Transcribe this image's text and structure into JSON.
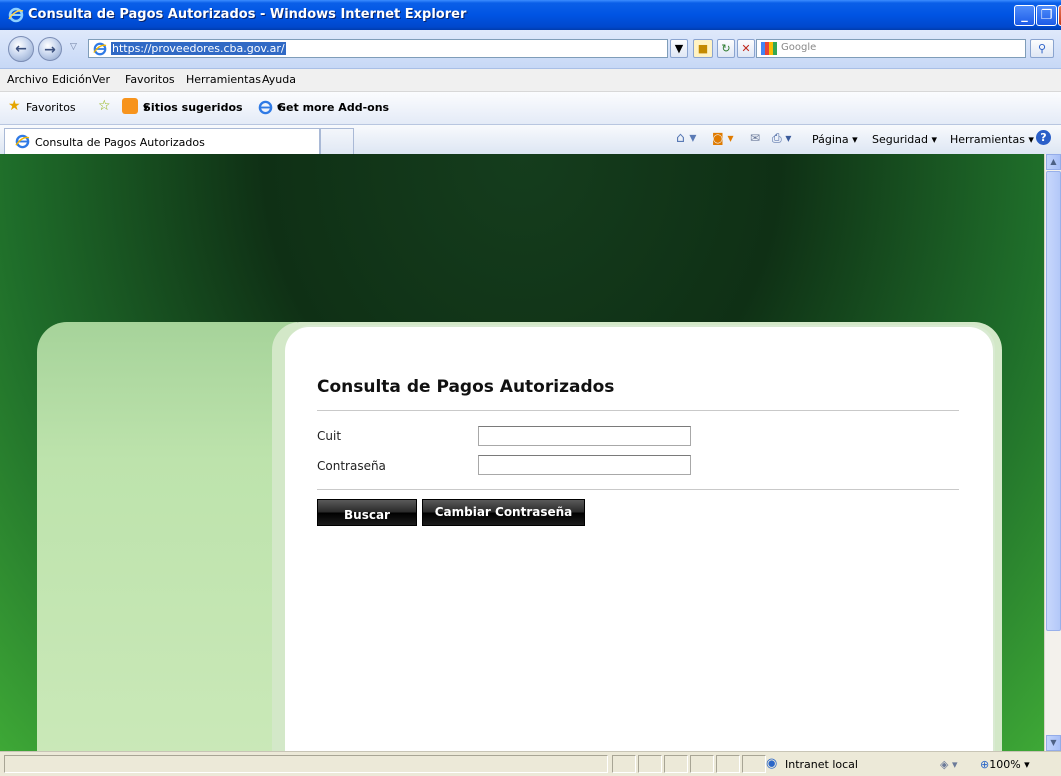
{
  "window": {
    "title": "Consulta de Pagos Autorizados - Windows Internet Explorer",
    "minimize": "_",
    "maximize": "❐",
    "close": "x"
  },
  "address": {
    "url": "https://proveedores.cba.gov.ar/",
    "search_placeholder": "Google"
  },
  "menu": [
    "Archivo",
    "Edición",
    "Ver",
    "Favoritos",
    "Herramientas",
    "Ayuda"
  ],
  "favorites": {
    "label": "Favoritos",
    "suggested": "Sitios sugeridos",
    "addons": "Get more Add-ons"
  },
  "tab": {
    "title": "Consulta de Pagos Autorizados"
  },
  "commands": {
    "page": "Página",
    "security": "Seguridad",
    "tools": "Herramientas"
  },
  "form": {
    "title": "Consulta de Pagos Autorizados",
    "cuit_label": "Cuit",
    "cuit_value": "",
    "password_label": "Contraseña",
    "password_value": "",
    "search_button": "Buscar",
    "change_password_button": "Cambiar Contraseña"
  },
  "status": {
    "zone": "Intranet local",
    "zoom": "100%"
  },
  "colors": {
    "title_bar": "#0054e3",
    "page_dark_green": "#0f3015",
    "page_light_green": "#3ea836",
    "button_black": "#000000"
  }
}
